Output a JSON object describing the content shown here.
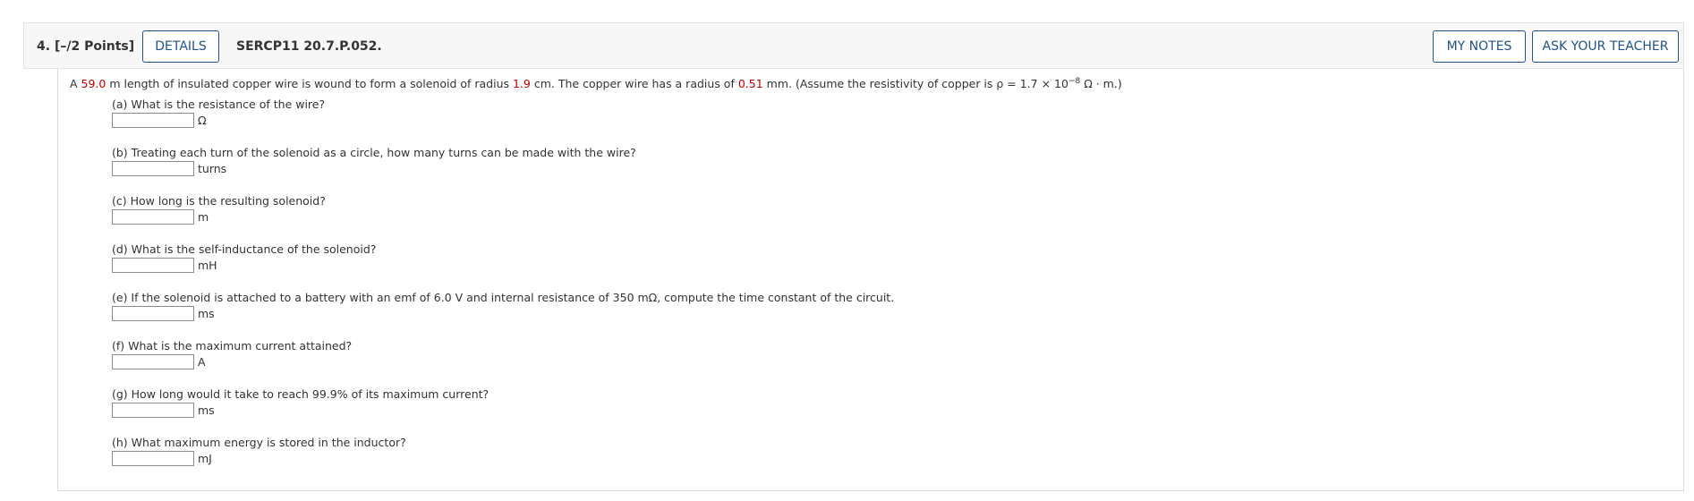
{
  "header": {
    "question_number": "4.",
    "points": "[–/2 Points]",
    "details_label": "DETAILS",
    "question_id": "SERCP11 20.7.P.052.",
    "my_notes_label": "MY NOTES",
    "ask_teacher_label": "ASK YOUR TEACHER"
  },
  "problem": {
    "t1": "A ",
    "length": "59.0",
    "t2": " m length of insulated copper wire is wound to form a solenoid of radius ",
    "solenoid_radius": "1.9",
    "t3": " cm. The copper wire has a radius of ",
    "wire_radius": "0.51",
    "t4": " mm. (Assume the resistivity of copper is ρ = 1.7 × 10",
    "exponent": "−8",
    "t5": " Ω · m.)"
  },
  "parts": [
    {
      "question": "(a) What is the resistance of the wire?",
      "unit": "Ω",
      "value": ""
    },
    {
      "question": "(b) Treating each turn of the solenoid as a circle, how many turns can be made with the wire?",
      "unit": "turns",
      "value": ""
    },
    {
      "question": "(c) How long is the resulting solenoid?",
      "unit": "m",
      "value": ""
    },
    {
      "question": "(d) What is the self-inductance of the solenoid?",
      "unit": "mH",
      "value": ""
    },
    {
      "question": "(e) If the solenoid is attached to a battery with an emf of 6.0 V and internal resistance of 350 mΩ, compute the time constant of the circuit.",
      "unit": "ms",
      "value": ""
    },
    {
      "question": "(f) What is the maximum current attained?",
      "unit": "A",
      "value": ""
    },
    {
      "question": "(g) How long would it take to reach 99.9% of its maximum current?",
      "unit": "ms",
      "value": ""
    },
    {
      "question": "(h) What maximum energy is stored in the inductor?",
      "unit": "mJ",
      "value": ""
    }
  ]
}
